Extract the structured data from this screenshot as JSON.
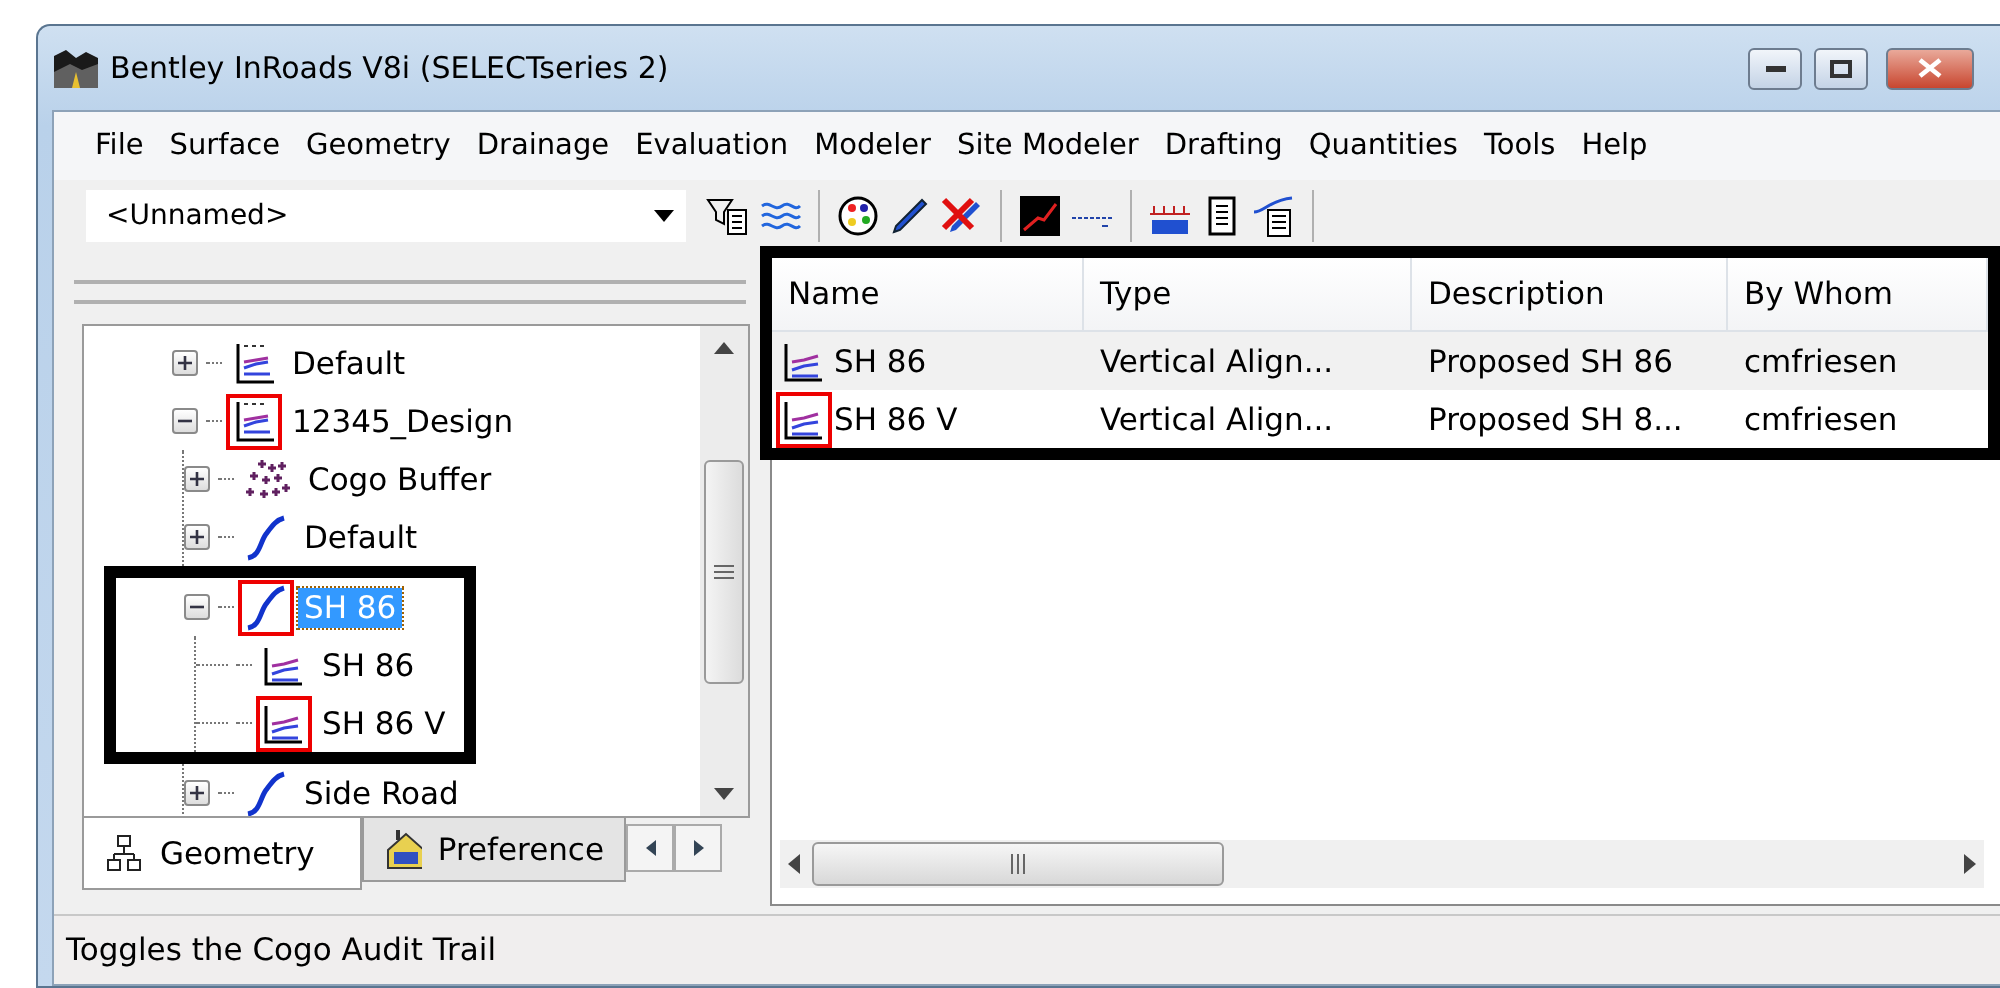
{
  "window": {
    "title": "Bentley InRoads V8i (SELECTseries 2)"
  },
  "menu": [
    "File",
    "Surface",
    "Geometry",
    "Drainage",
    "Evaluation",
    "Modeler",
    "Site Modeler",
    "Drafting",
    "Quantities",
    "Tools",
    "Help"
  ],
  "toolbar": {
    "project_combo": {
      "value": "<Unnamed>"
    }
  },
  "tree": {
    "items": [
      {
        "label": "Default",
        "kind": "profile-set",
        "expanded": false,
        "active": false,
        "selected": false,
        "outlined": false
      },
      {
        "label": "12345_Design",
        "kind": "profile-set",
        "expanded": true,
        "active": true,
        "selected": false,
        "outlined": false,
        "children": [
          {
            "label": "Cogo Buffer",
            "kind": "cogo",
            "expanded": false,
            "active": false,
            "selected": false,
            "outlined": false
          },
          {
            "label": "Default",
            "kind": "alignment",
            "expanded": false,
            "active": false,
            "selected": false,
            "outlined": false
          },
          {
            "label": "SH 86",
            "kind": "alignment",
            "expanded": true,
            "active": true,
            "selected": true,
            "outlined": true,
            "children": [
              {
                "label": "SH 86",
                "kind": "profile",
                "active": false,
                "selected": false,
                "outlined": false
              },
              {
                "label": "SH 86 V",
                "kind": "profile",
                "active": true,
                "selected": false,
                "outlined": false
              }
            ]
          },
          {
            "label": "Side Road",
            "kind": "alignment",
            "expanded": false,
            "active": false,
            "selected": false,
            "outlined": false
          }
        ]
      }
    ]
  },
  "tabs": [
    {
      "label": "Geometry",
      "kind": "geometry",
      "selected": true
    },
    {
      "label": "Preference",
      "kind": "preferences",
      "selected": false
    }
  ],
  "list": {
    "outlined": true,
    "columns": [
      "Name",
      "Type",
      "Description",
      "By Whom"
    ],
    "rows": [
      {
        "cells": [
          "SH 86",
          "Vertical Align...",
          "Proposed SH 86",
          "cmfriesen"
        ],
        "active": false
      },
      {
        "cells": [
          "SH 86 V",
          "Vertical Align...",
          "Proposed SH 8...",
          "cmfriesen"
        ],
        "active": true
      }
    ]
  },
  "status_bar": {
    "text": "Toggles the Cogo Audit Trail"
  }
}
